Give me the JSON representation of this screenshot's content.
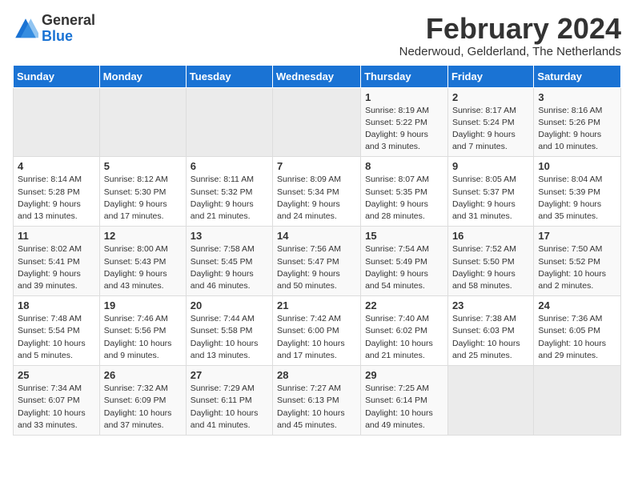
{
  "logo": {
    "general": "General",
    "blue": "Blue"
  },
  "title": "February 2024",
  "location": "Nederwoud, Gelderland, The Netherlands",
  "days_of_week": [
    "Sunday",
    "Monday",
    "Tuesday",
    "Wednesday",
    "Thursday",
    "Friday",
    "Saturday"
  ],
  "weeks": [
    [
      {
        "day": "",
        "info": ""
      },
      {
        "day": "",
        "info": ""
      },
      {
        "day": "",
        "info": ""
      },
      {
        "day": "",
        "info": ""
      },
      {
        "day": "1",
        "info": "Sunrise: 8:19 AM\nSunset: 5:22 PM\nDaylight: 9 hours\nand 3 minutes."
      },
      {
        "day": "2",
        "info": "Sunrise: 8:17 AM\nSunset: 5:24 PM\nDaylight: 9 hours\nand 7 minutes."
      },
      {
        "day": "3",
        "info": "Sunrise: 8:16 AM\nSunset: 5:26 PM\nDaylight: 9 hours\nand 10 minutes."
      }
    ],
    [
      {
        "day": "4",
        "info": "Sunrise: 8:14 AM\nSunset: 5:28 PM\nDaylight: 9 hours\nand 13 minutes."
      },
      {
        "day": "5",
        "info": "Sunrise: 8:12 AM\nSunset: 5:30 PM\nDaylight: 9 hours\nand 17 minutes."
      },
      {
        "day": "6",
        "info": "Sunrise: 8:11 AM\nSunset: 5:32 PM\nDaylight: 9 hours\nand 21 minutes."
      },
      {
        "day": "7",
        "info": "Sunrise: 8:09 AM\nSunset: 5:34 PM\nDaylight: 9 hours\nand 24 minutes."
      },
      {
        "day": "8",
        "info": "Sunrise: 8:07 AM\nSunset: 5:35 PM\nDaylight: 9 hours\nand 28 minutes."
      },
      {
        "day": "9",
        "info": "Sunrise: 8:05 AM\nSunset: 5:37 PM\nDaylight: 9 hours\nand 31 minutes."
      },
      {
        "day": "10",
        "info": "Sunrise: 8:04 AM\nSunset: 5:39 PM\nDaylight: 9 hours\nand 35 minutes."
      }
    ],
    [
      {
        "day": "11",
        "info": "Sunrise: 8:02 AM\nSunset: 5:41 PM\nDaylight: 9 hours\nand 39 minutes."
      },
      {
        "day": "12",
        "info": "Sunrise: 8:00 AM\nSunset: 5:43 PM\nDaylight: 9 hours\nand 43 minutes."
      },
      {
        "day": "13",
        "info": "Sunrise: 7:58 AM\nSunset: 5:45 PM\nDaylight: 9 hours\nand 46 minutes."
      },
      {
        "day": "14",
        "info": "Sunrise: 7:56 AM\nSunset: 5:47 PM\nDaylight: 9 hours\nand 50 minutes."
      },
      {
        "day": "15",
        "info": "Sunrise: 7:54 AM\nSunset: 5:49 PM\nDaylight: 9 hours\nand 54 minutes."
      },
      {
        "day": "16",
        "info": "Sunrise: 7:52 AM\nSunset: 5:50 PM\nDaylight: 9 hours\nand 58 minutes."
      },
      {
        "day": "17",
        "info": "Sunrise: 7:50 AM\nSunset: 5:52 PM\nDaylight: 10 hours\nand 2 minutes."
      }
    ],
    [
      {
        "day": "18",
        "info": "Sunrise: 7:48 AM\nSunset: 5:54 PM\nDaylight: 10 hours\nand 5 minutes."
      },
      {
        "day": "19",
        "info": "Sunrise: 7:46 AM\nSunset: 5:56 PM\nDaylight: 10 hours\nand 9 minutes."
      },
      {
        "day": "20",
        "info": "Sunrise: 7:44 AM\nSunset: 5:58 PM\nDaylight: 10 hours\nand 13 minutes."
      },
      {
        "day": "21",
        "info": "Sunrise: 7:42 AM\nSunset: 6:00 PM\nDaylight: 10 hours\nand 17 minutes."
      },
      {
        "day": "22",
        "info": "Sunrise: 7:40 AM\nSunset: 6:02 PM\nDaylight: 10 hours\nand 21 minutes."
      },
      {
        "day": "23",
        "info": "Sunrise: 7:38 AM\nSunset: 6:03 PM\nDaylight: 10 hours\nand 25 minutes."
      },
      {
        "day": "24",
        "info": "Sunrise: 7:36 AM\nSunset: 6:05 PM\nDaylight: 10 hours\nand 29 minutes."
      }
    ],
    [
      {
        "day": "25",
        "info": "Sunrise: 7:34 AM\nSunset: 6:07 PM\nDaylight: 10 hours\nand 33 minutes."
      },
      {
        "day": "26",
        "info": "Sunrise: 7:32 AM\nSunset: 6:09 PM\nDaylight: 10 hours\nand 37 minutes."
      },
      {
        "day": "27",
        "info": "Sunrise: 7:29 AM\nSunset: 6:11 PM\nDaylight: 10 hours\nand 41 minutes."
      },
      {
        "day": "28",
        "info": "Sunrise: 7:27 AM\nSunset: 6:13 PM\nDaylight: 10 hours\nand 45 minutes."
      },
      {
        "day": "29",
        "info": "Sunrise: 7:25 AM\nSunset: 6:14 PM\nDaylight: 10 hours\nand 49 minutes."
      },
      {
        "day": "",
        "info": ""
      },
      {
        "day": "",
        "info": ""
      }
    ]
  ]
}
